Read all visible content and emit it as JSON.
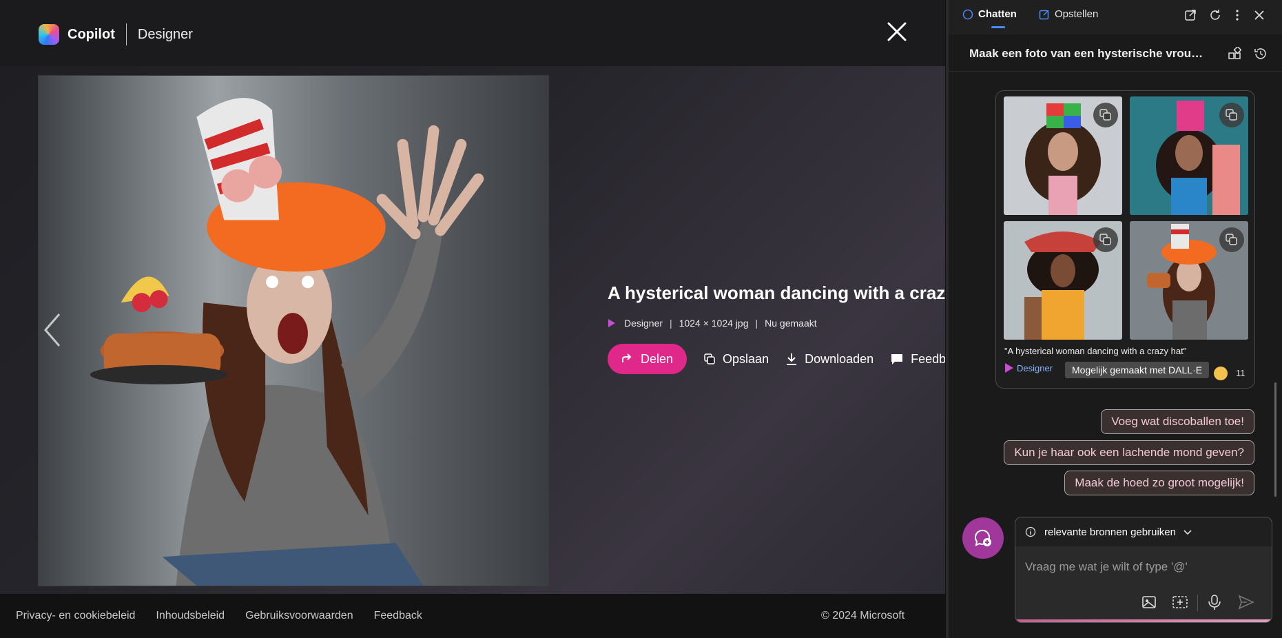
{
  "viewer": {
    "brand_name": "Copilot",
    "brand_sub": "Designer",
    "image_title": "A hysterical woman dancing with a crazy ha",
    "meta": {
      "source": "Designer",
      "size": "1024 × 1024 jpg",
      "status": "Nu gemaakt"
    },
    "actions": {
      "share": "Delen",
      "save": "Opslaan",
      "download": "Downloaden",
      "feedback": "Feedba"
    },
    "footer": {
      "links": [
        "Privacy- en cookiebeleid",
        "Inhoudsbeleid",
        "Gebruiksvoorwaarden",
        "Feedback"
      ],
      "copyright": "© 2024 Microsoft"
    }
  },
  "sidebar": {
    "tabs": {
      "chat": "Chatten",
      "compose": "Opstellen"
    },
    "conversation_title": "Maak een foto van een hysterische vrouw d...",
    "card": {
      "caption": "\"A hysterical woman dancing with a crazy hat\"",
      "designer_label": "Designer",
      "tooltip": "Mogelijk gemaakt met DALL·E",
      "count": "11"
    },
    "suggestions": [
      "Voeg wat discoballen toe!",
      "Kun je haar ook een lachende mond geven?",
      "Maak de hoed zo groot mogelijk!"
    ],
    "composer": {
      "sources_label": "relevante bronnen gebruiken",
      "placeholder": "Vraag me wat je wilt of type '@'"
    }
  },
  "colors": {
    "accent_pink": "#e0288a",
    "link_blue": "#8ab4ff",
    "avatar_purple": "#a0379b"
  }
}
